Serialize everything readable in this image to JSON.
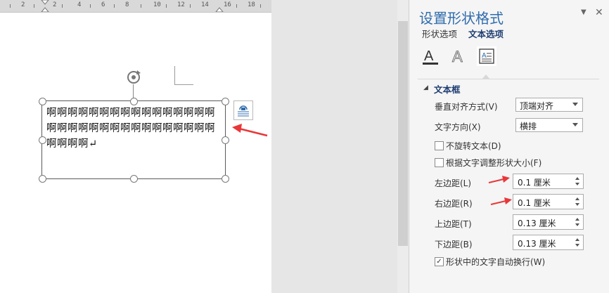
{
  "document": {
    "ruler_numbers": [
      "2",
      "2",
      "4",
      "6",
      "8",
      "10",
      "12",
      "14",
      "16",
      "18"
    ],
    "textbox_text": "啊啊啊啊啊啊啊啊啊啊啊啊啊啊啊啊啊啊啊啊啊啊啊啊啊啊啊啊啊啊啊啊啊啊啊啊↵"
  },
  "panel": {
    "title": "设置形状格式",
    "tabs": [
      {
        "label": "形状选项",
        "active": false
      },
      {
        "label": "文本选项",
        "active": true
      }
    ],
    "section_title": "文本框",
    "vertical_align": {
      "label": "垂直对齐方式(V)",
      "value": "顶端对齐"
    },
    "text_direction": {
      "label": "文字方向(X)",
      "value": "横排"
    },
    "no_rotate": {
      "label": "不旋转文本(D)",
      "checked": false
    },
    "resize_shape": {
      "label": "根据文字调整形状大小(F)",
      "checked": false
    },
    "left_margin": {
      "label": "左边距(L)",
      "value": "0.1 厘米"
    },
    "right_margin": {
      "label": "右边距(R)",
      "value": "0.1 厘米"
    },
    "top_margin": {
      "label": "上边距(T)",
      "value": "0.13 厘米"
    },
    "bottom_margin": {
      "label": "下边距(B)",
      "value": "0.13 厘米"
    },
    "wrap_text": {
      "label": "形状中的文字自动换行(W)",
      "checked": true
    }
  },
  "colors": {
    "accent": "#2f6cad",
    "arrow": "#e8383a"
  },
  "icons": [
    "rotate-icon",
    "layout-options-icon",
    "text-fill-icon",
    "text-effects-icon",
    "textbox-icon",
    "close-icon",
    "dropdown-icon",
    "collapse-arrow-icon"
  ]
}
